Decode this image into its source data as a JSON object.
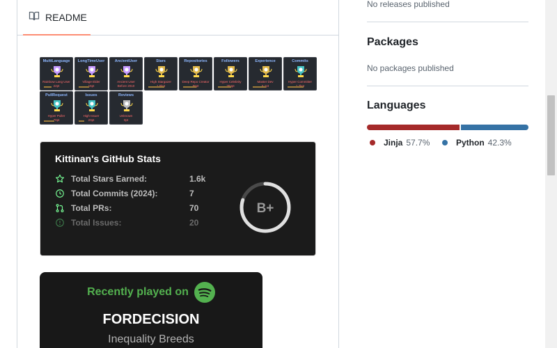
{
  "readme": {
    "tab_label": "README"
  },
  "trophies": [
    {
      "title": "MultiLanguage",
      "sub1": "Rainbow Lang User",
      "sub2": "22pt",
      "cup_color": "#c79bff",
      "progress": 0.3
    },
    {
      "title": "LongTimeUser",
      "sub1": "Village Elder",
      "sub2": "16pt",
      "cup_color": "#c79bff",
      "progress": 0.4
    },
    {
      "title": "AncientUser",
      "sub1": "Ancient User",
      "sub2": "Before 2010",
      "cup_color": "#c79bff",
      "progress": 0.0
    },
    {
      "title": "Stars",
      "sub1": "High Stargazer",
      "sub2": "1.6kpt",
      "cup_color": "#e0b84a",
      "progress": 0.6
    },
    {
      "title": "Repositories",
      "sub1": "Deep Repo Creator",
      "sub2": "86pt",
      "cup_color": "#e0b84a",
      "progress": 0.5
    },
    {
      "title": "Followers",
      "sub1": "Hyper Celebrity",
      "sub2": "384pt",
      "cup_color": "#e0b84a",
      "progress": 0.5
    },
    {
      "title": "Experience",
      "sub1": "Master Dev",
      "sub2": "6.1pt",
      "cup_color": "#e0b84a",
      "progress": 0.5
    },
    {
      "title": "Commits",
      "sub1": "Hyper Committer",
      "sub2": "1.7kpt",
      "cup_color": "#46c4c4",
      "progress": 0.6
    },
    {
      "title": "PullRequest",
      "sub1": "Hyper Puller",
      "sub2": "70pt",
      "cup_color": "#46c4c4",
      "progress": 0.4
    },
    {
      "title": "Issues",
      "sub1": "High Issuer",
      "sub2": "20pt",
      "cup_color": "#46c4c4",
      "progress": 0.2
    },
    {
      "title": "Reviews",
      "sub1": "Unknown",
      "sub2": "0pt",
      "cup_color": "#bdbdbd",
      "progress": 0.0
    }
  ],
  "stats": {
    "title": "Kittinan's GitHub Stats",
    "rows": [
      {
        "label": "Total Stars Earned:",
        "value": "1.6k",
        "icon": "star-icon"
      },
      {
        "label": "Total Commits (2024):",
        "value": "7",
        "icon": "history-icon"
      },
      {
        "label": "Total PRs:",
        "value": "70",
        "icon": "pull-request-icon"
      },
      {
        "label": "Total Issues:",
        "value": "20",
        "icon": "issue-icon"
      }
    ],
    "rank": "B+",
    "rank_progress": 0.8,
    "accent_color": "#79ff97"
  },
  "spotify": {
    "heading": "Recently played on",
    "song": "FORDECISION",
    "artist": "Inequality Breeds",
    "brand_color": "#53b14f"
  },
  "sidebar": {
    "releases_text": "No releases published",
    "packages_heading": "Packages",
    "packages_text": "No packages published",
    "languages_heading": "Languages",
    "languages": [
      {
        "name": "Jinja",
        "percent": "57.7%",
        "value": 57.7,
        "color": "#a52a2a"
      },
      {
        "name": "Python",
        "percent": "42.3%",
        "value": 42.3,
        "color": "#3572a5"
      }
    ]
  }
}
